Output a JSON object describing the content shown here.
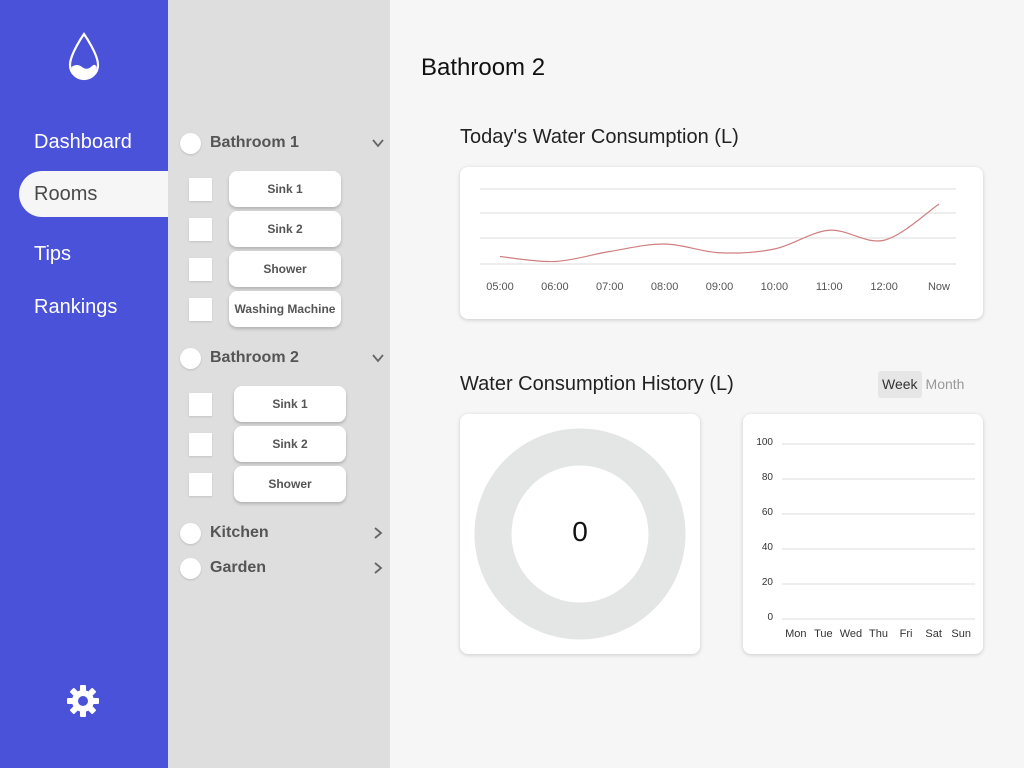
{
  "sidebar": {
    "logo_icon": "water-drop-icon",
    "nav": [
      "Dashboard",
      "Rooms",
      "Tips",
      "Rankings"
    ],
    "active": "Rooms",
    "settings_icon": "gear-icon",
    "accent": "#4a52d9"
  },
  "rooms": {
    "bathroom1": {
      "name": "Bathroom 1",
      "devices": [
        "Sink 1",
        "Sink 2",
        "Shower",
        "Washing Machine"
      ]
    },
    "bathroom2": {
      "name": "Bathroom 2",
      "devices": [
        "Sink 1",
        "Sink 2",
        "Shower"
      ]
    },
    "kitchen": {
      "name": "Kitchen"
    },
    "garden": {
      "name": "Garden"
    }
  },
  "main": {
    "title": "Bathroom 2",
    "today_title": "Today's Water Consumption (L)",
    "history_title": "Water Consumption History (L)",
    "toggle": {
      "week": "Week",
      "month": "Month",
      "selected": "Week"
    },
    "donut_value": "0"
  },
  "chart_data": [
    {
      "type": "line",
      "title": "Today's Water Consumption (L)",
      "categories": [
        "05:00",
        "06:00",
        "07:00",
        "08:00",
        "09:00",
        "10:00",
        "11:00",
        "12:00",
        "Now"
      ],
      "values": [
        0.3,
        0.1,
        0.5,
        0.8,
        0.45,
        0.6,
        1.35,
        0.95,
        2.4
      ],
      "ylim": [
        0,
        3
      ],
      "grid": true,
      "line_color": "#d08080"
    },
    {
      "type": "pie",
      "style": "donut",
      "center_label": "0",
      "values": [
        0
      ],
      "ring_color": "#e4e5e5"
    },
    {
      "type": "bar",
      "categories": [
        "Mon",
        "Tue",
        "Wed",
        "Thu",
        "Fri",
        "Sat",
        "Sun"
      ],
      "values": [
        0,
        0,
        0,
        0,
        0,
        0,
        0
      ],
      "yticks": [
        100,
        80,
        60,
        40,
        20,
        0
      ],
      "ylim": [
        0,
        100
      ],
      "grid": true
    }
  ]
}
